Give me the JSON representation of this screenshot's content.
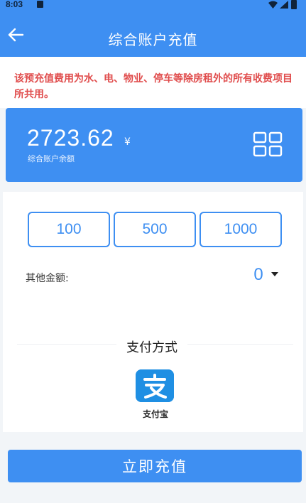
{
  "status_bar": {
    "time": "8:03"
  },
  "header": {
    "title": "综合账户充值",
    "back_icon": "arrow-left-icon"
  },
  "notice": {
    "text": "该预充值费用为水、电、物业、停车等除房租外的所有收费项目所共用。",
    "color": "#e04c4c"
  },
  "balance": {
    "amount": "2723.62",
    "unit": "¥",
    "label": "综合账户余额",
    "menu_icon": "grid-icon"
  },
  "amounts": [
    "100",
    "500",
    "1000"
  ],
  "other_amount": {
    "label": "其他金额:",
    "value": "0"
  },
  "payment": {
    "title": "支付方式",
    "method_label": "支付宝",
    "method_icon": "alipay-icon"
  },
  "submit": {
    "label": "立即充值"
  },
  "colors": {
    "primary": "#3e8ff2",
    "alipay": "#1f8fe3",
    "warning": "#e04c4c"
  }
}
